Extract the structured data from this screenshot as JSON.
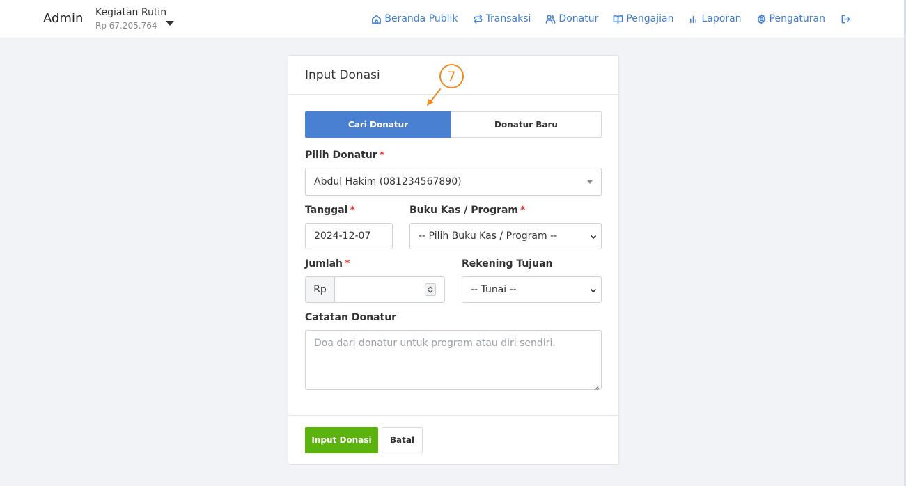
{
  "navbar": {
    "brand": "Admin",
    "org": {
      "name": "Kegiatan Rutin",
      "balance": "Rp 67.205.764"
    },
    "items": [
      {
        "label": "Beranda Publik",
        "icon": "home-icon"
      },
      {
        "label": "Transaksi",
        "icon": "repeat-icon"
      },
      {
        "label": "Donatur",
        "icon": "users-icon"
      },
      {
        "label": "Pengajian",
        "icon": "book-open-icon"
      },
      {
        "label": "Laporan",
        "icon": "bar-chart-icon"
      },
      {
        "label": "Pengaturan",
        "icon": "gear-icon"
      }
    ],
    "logout_icon": "logout-icon"
  },
  "form": {
    "title": "Input Donasi",
    "tabs": {
      "search": "Cari Donatur",
      "new": "Donatur Baru",
      "active": "search"
    },
    "donor": {
      "label": "Pilih Donatur",
      "value": "Abdul Hakim (081234567890)"
    },
    "date": {
      "label": "Tanggal",
      "value": "2024-12-07"
    },
    "program": {
      "label": "Buku Kas / Program",
      "value": "-- Pilih Buku Kas / Program --"
    },
    "amount": {
      "label": "Jumlah",
      "prefix": "Rp",
      "value": ""
    },
    "account": {
      "label": "Rekening Tujuan",
      "value": "-- Tunai --"
    },
    "notes": {
      "label": "Catatan Donatur",
      "placeholder": "Doa dari donatur untuk program atau diri sendiri."
    },
    "required_mark": "*",
    "submit": "Input Donasi",
    "cancel": "Batal"
  },
  "annotation": {
    "step": "7",
    "color": "#f08a1c"
  },
  "colors": {
    "primary": "#4a80d1",
    "success": "#5cb30e",
    "link": "#3b7dd8",
    "required": "#d63a3a"
  }
}
